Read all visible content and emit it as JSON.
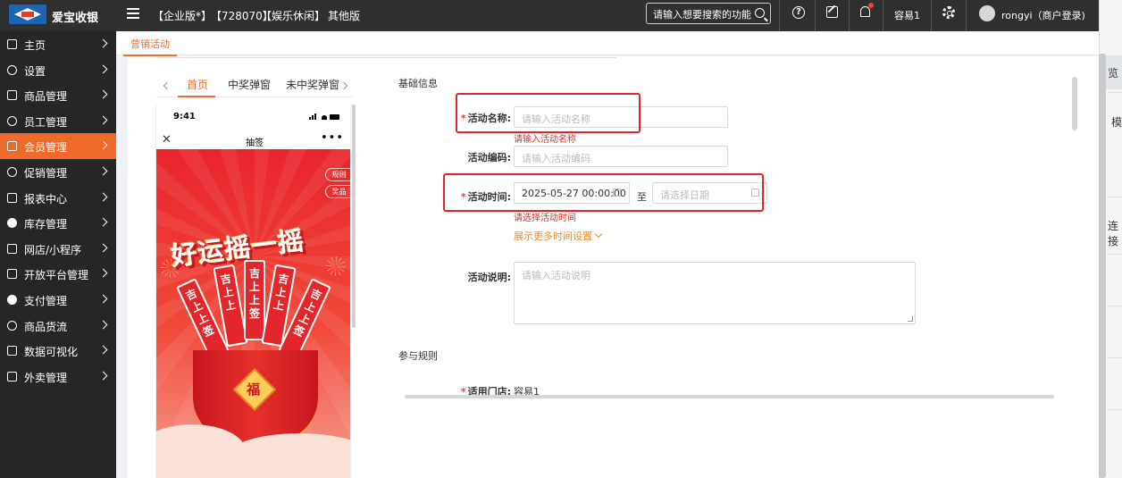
{
  "topbar": {
    "app_name": "爱宝收银",
    "tags": [
      "【企业版*】",
      "【728070】",
      "【娱乐休闲】",
      "其他版"
    ],
    "search_placeholder": "请输入想要搜索的功能",
    "store_name": "容易1",
    "user_label": "rongyi（商户登录)"
  },
  "sidebar": {
    "items": [
      {
        "label": "主页",
        "icon": "home-icon"
      },
      {
        "label": "设置",
        "icon": "settings-icon"
      },
      {
        "label": "商品管理",
        "icon": "goods-icon"
      },
      {
        "label": "员工管理",
        "icon": "staff-icon"
      },
      {
        "label": "会员管理",
        "icon": "member-icon",
        "active": true
      },
      {
        "label": "促销管理",
        "icon": "promo-icon"
      },
      {
        "label": "报表中心",
        "icon": "report-icon"
      },
      {
        "label": "库存管理",
        "icon": "stock-icon"
      },
      {
        "label": "网店/小程序",
        "icon": "shop-icon"
      },
      {
        "label": "开放平台管理",
        "icon": "platform-icon"
      },
      {
        "label": "支付管理",
        "icon": "pay-icon"
      },
      {
        "label": "商品货流",
        "icon": "flow-icon"
      },
      {
        "label": "数据可视化",
        "icon": "chart-icon"
      },
      {
        "label": "外卖管理",
        "icon": "takeout-icon"
      }
    ]
  },
  "tabs": {
    "active": "营销活动"
  },
  "preview": {
    "tabs": [
      "首页",
      "中奖弹窗",
      "未中奖弹窗"
    ],
    "phone_time": "9:41",
    "phone_title": "抽签",
    "side_rule": "规则",
    "side_prize": "奖品",
    "poster_title": "好运摇一摇",
    "stick_text": [
      "吉上上签",
      "吉上上",
      "吉上上签",
      "吉上上",
      "吉上上签"
    ],
    "fu_char": "福"
  },
  "form": {
    "basic_title": "基础信息",
    "name_label": "活动名称:",
    "name_placeholder": "请输入活动名称",
    "name_error": "请输入活动名称",
    "code_label": "活动编码:",
    "code_placeholder": "请输入活动编码",
    "time_label": "活动时间:",
    "start_time": "2025-05-27 00:00:00",
    "range_sep": "至",
    "end_placeholder": "请选择日期",
    "time_error": "请选择活动时间",
    "more_time_link": "展示更多时间设置",
    "desc_label": "活动说明:",
    "desc_placeholder": "请输入活动说明",
    "rules_title": "参与规则",
    "store_label": "适用门店:",
    "store_value": "容易1"
  },
  "right_panel": {
    "items": [
      "览",
      "模",
      "连接"
    ]
  }
}
